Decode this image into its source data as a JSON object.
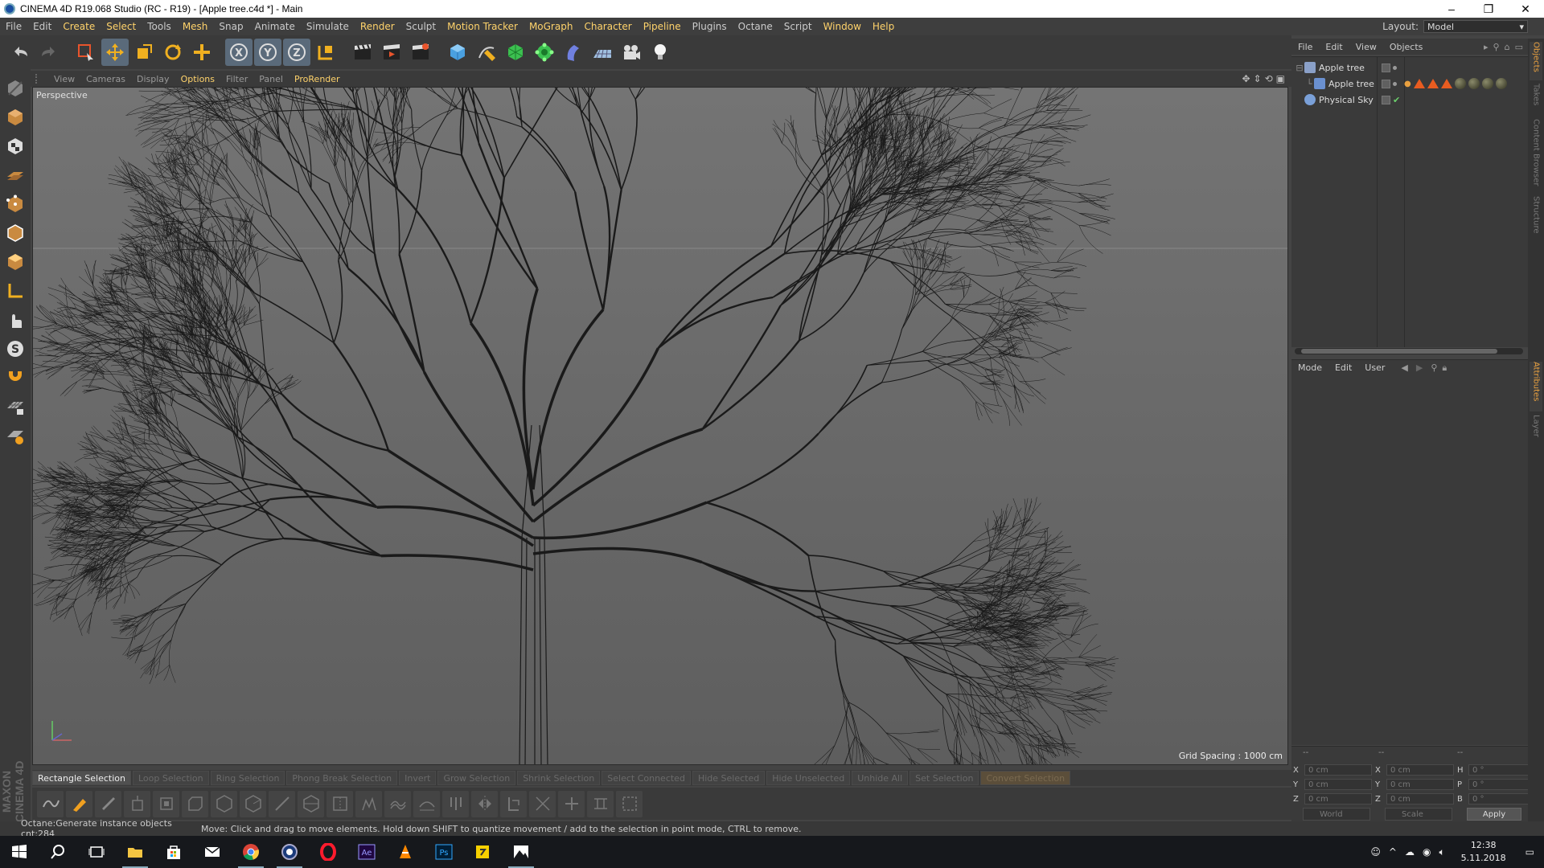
{
  "window": {
    "title": "CINEMA 4D R19.068 Studio (RC - R19) - [Apple tree.c4d *] - Main",
    "minimize_glyph": "–",
    "restore_glyph": "❐",
    "close_glyph": "✕"
  },
  "menubar": {
    "items": [
      "File",
      "Edit",
      "Create",
      "Select",
      "Tools",
      "Mesh",
      "Snap",
      "Animate",
      "Simulate",
      "Render",
      "Sculpt",
      "Motion Tracker",
      "MoGraph",
      "Character",
      "Pipeline",
      "Plugins",
      "Octane",
      "Script",
      "Window",
      "Help"
    ],
    "layout_label": "Layout:",
    "layout_value": "Model"
  },
  "viewport_menu": {
    "items": [
      "View",
      "Cameras",
      "Display",
      "Options",
      "Filter",
      "Panel",
      "ProRender"
    ]
  },
  "viewport": {
    "camera_label": "Perspective",
    "grid_spacing": "Grid Spacing : 1000 cm"
  },
  "selection_bar": {
    "items": [
      "Rectangle Selection",
      "Loop Selection",
      "Ring Selection",
      "Phong Break Selection",
      "Invert",
      "Grow Selection",
      "Shrink Selection",
      "Select Connected",
      "Hide Selected",
      "Hide Unselected",
      "Unhide All",
      "Set Selection",
      "Convert Selection"
    ]
  },
  "status": {
    "left": "Octane:Generate instance objects cnt:284",
    "message": "Move: Click and drag to move elements. Hold down SHIFT to quantize movement / add to the selection in point mode, CTRL to remove."
  },
  "object_manager": {
    "menu": [
      "File",
      "Edit",
      "View",
      "Objects"
    ],
    "objects": [
      {
        "name": "Apple tree",
        "indent": 0,
        "icon_color": "#8aa0c8"
      },
      {
        "name": "Apple tree",
        "indent": 1,
        "icon_color": "#6a90d0"
      },
      {
        "name": "Physical Sky",
        "indent": 0,
        "icon_color": "#7aa0d8"
      }
    ]
  },
  "attributes": {
    "menu": [
      "Mode",
      "Edit",
      "User"
    ]
  },
  "coordinates": {
    "headers": [
      "--",
      "--",
      "--"
    ],
    "rows": [
      {
        "a": "X",
        "av": "0 cm",
        "b": "X",
        "bv": "0 cm",
        "c": "H",
        "cv": "0 °"
      },
      {
        "a": "Y",
        "av": "0 cm",
        "b": "Y",
        "bv": "0 cm",
        "c": "P",
        "cv": "0 °"
      },
      {
        "a": "Z",
        "av": "0 cm",
        "b": "Z",
        "bv": "0 cm",
        "c": "B",
        "cv": "0 °"
      }
    ],
    "world": "World",
    "scale": "Scale",
    "apply": "Apply"
  },
  "side_tabs": [
    "Objects",
    "Takes",
    "Content Browser",
    "Structure",
    "Attributes",
    "Layer"
  ],
  "maxon": "MAXON CINEMA 4D",
  "taskbar": {
    "time": "12:38",
    "date": "5.11.2018"
  },
  "colors": {
    "accent": "#ffd36b",
    "tag_orange": "#e85c20",
    "panel": "#3a3a3a"
  }
}
